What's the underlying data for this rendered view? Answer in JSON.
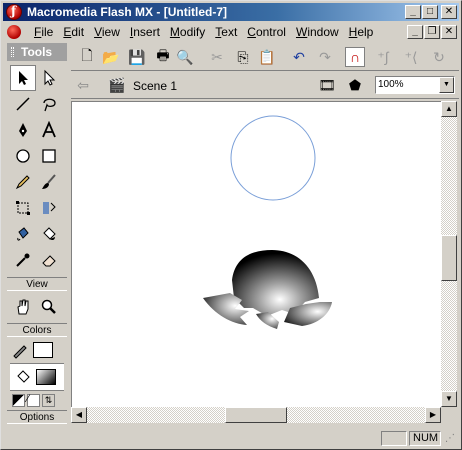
{
  "window": {
    "title": "Macromedia Flash MX - [Untitled-7]",
    "buttons": {
      "minimize": "_",
      "maximize": "□",
      "close": "✕"
    }
  },
  "menubar": {
    "items": [
      {
        "label": "File",
        "key": "F",
        "rest": "ile"
      },
      {
        "label": "Edit",
        "key": "E",
        "rest": "dit"
      },
      {
        "label": "View",
        "key": "V",
        "rest": "iew"
      },
      {
        "label": "Insert",
        "key": "I",
        "rest": "nsert"
      },
      {
        "label": "Modify",
        "key": "M",
        "rest": "odify"
      },
      {
        "label": "Text",
        "key": "T",
        "rest": "ext"
      },
      {
        "label": "Control",
        "key": "C",
        "rest": "ontrol"
      },
      {
        "label": "Window",
        "key": "W",
        "rest": "indow"
      },
      {
        "label": "Help",
        "key": "H",
        "rest": "elp"
      }
    ]
  },
  "tools": {
    "title": "Tools",
    "view_label": "View",
    "colors_label": "Colors",
    "options_label": "Options"
  },
  "timeline": {
    "scene": "Scene 1",
    "zoom": "100%"
  },
  "status": {
    "num": "NUM"
  },
  "colors": {
    "title_start": "#0a246a",
    "title_end": "#a6caf0",
    "stroke_circle": "#7a9fd8"
  }
}
